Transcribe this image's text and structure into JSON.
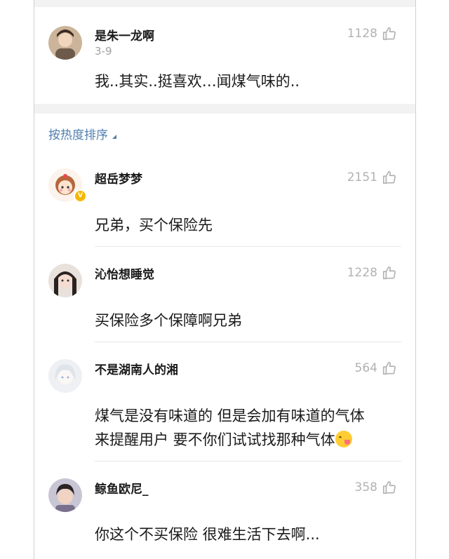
{
  "top_comment": {
    "author": "是朱一龙啊",
    "date": "3-9",
    "likes": "1128",
    "text": "我..其实..挺喜欢…闻煤气味的.."
  },
  "sort_label": "按热度排序",
  "comments": [
    {
      "author": "超岳梦梦",
      "likes": "2151",
      "text": "兄弟，买个保险先"
    },
    {
      "author": "沁怡想睡觉",
      "likes": "1228",
      "text": "买保险多个保障啊兄弟"
    },
    {
      "author": "不是湖南人的湘",
      "likes": "564",
      "text_line1": "煤气是没有味道的 但是会加有味道的气体",
      "text_line2": "来提醒用户 要不你们试试找那种气体"
    },
    {
      "author": "鲸鱼欧尼_",
      "likes": "358",
      "text": "你这个不买保险 很难生活下去啊..."
    }
  ],
  "colors": {
    "link": "#4f7fb0",
    "muted": "#a0a0a0",
    "badge": "#f5b800",
    "gap": "#f2f2f2"
  }
}
